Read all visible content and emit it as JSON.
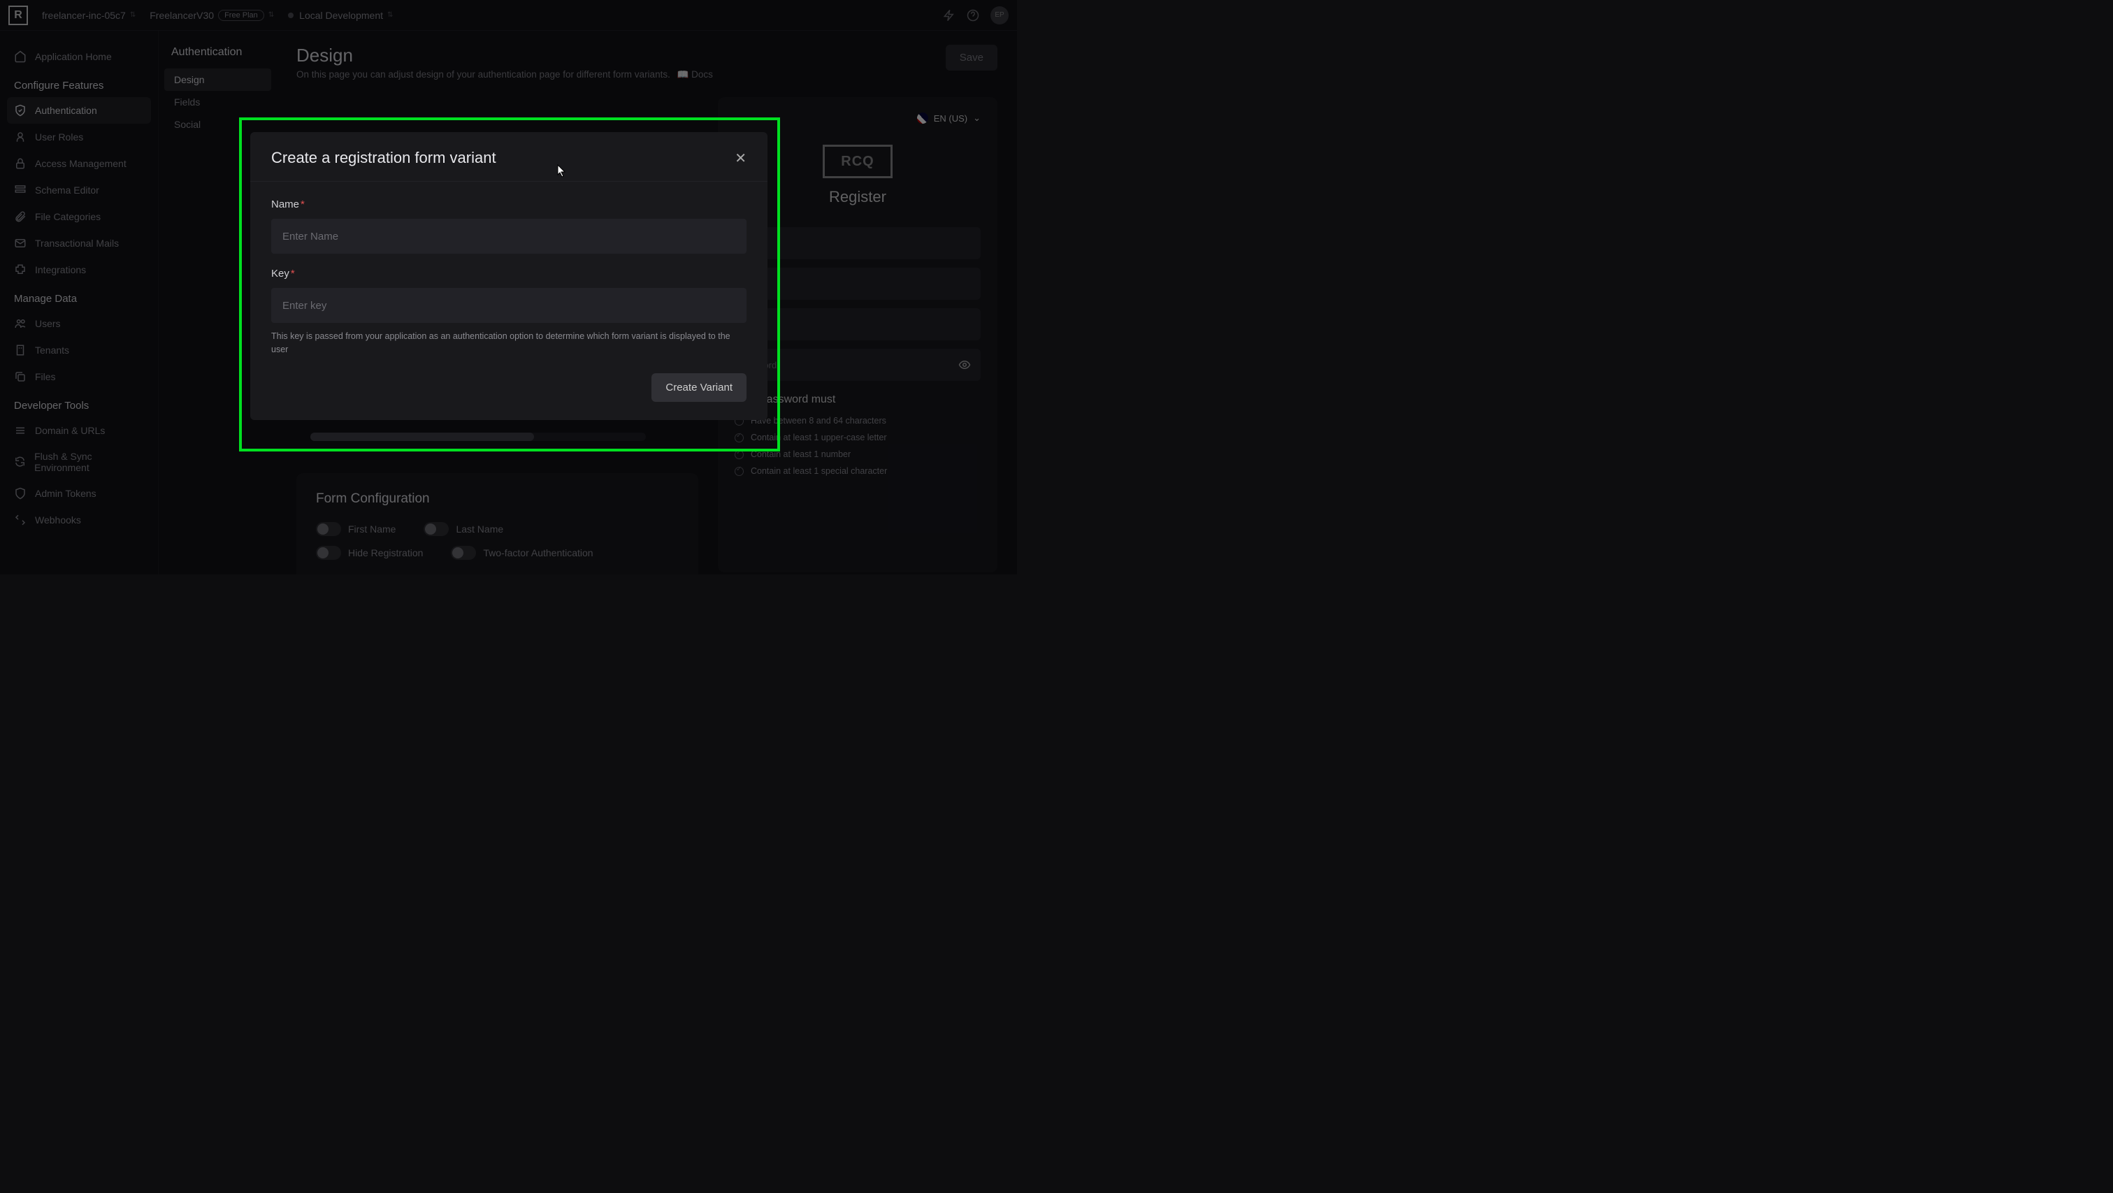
{
  "topbar": {
    "org": "freelancer-inc-05c7",
    "project": "FreelancerV30",
    "plan_badge": "Free Plan",
    "env": "Local Development",
    "avatar_initials": "EP"
  },
  "sidebar": {
    "home": "Application Home",
    "section_configure": "Configure Features",
    "items_configure": [
      "Authentication",
      "User Roles",
      "Access Management",
      "Schema Editor",
      "File Categories",
      "Transactional Mails",
      "Integrations"
    ],
    "section_manage": "Manage Data",
    "items_manage": [
      "Users",
      "Tenants",
      "Files"
    ],
    "section_dev": "Developer Tools",
    "items_dev": [
      "Domain & URLs",
      "Flush & Sync Environment",
      "Admin Tokens",
      "Webhooks"
    ]
  },
  "sidebar2": {
    "title": "Authentication",
    "items": [
      "Design",
      "Fields",
      "Social"
    ]
  },
  "page": {
    "title": "Design",
    "desc": "On this page you can adjust design of your authentication page for different form variants.",
    "docs": "Docs",
    "save": "Save",
    "form_config_title": "Form Configuration",
    "toggles": [
      "First Name",
      "Last Name",
      "Hide Registration",
      "Two-factor Authentication"
    ]
  },
  "preview": {
    "lang": "EN (US)",
    "logo_text": "RCQ",
    "title": "Register",
    "password_placeholder": "*ssword",
    "pw_heading": "Your password must",
    "rules": [
      "Have between 8 and 64 characters",
      "Contain at least 1 upper-case letter",
      "Contain at least 1 number",
      "Contain at least 1 special character"
    ]
  },
  "modal": {
    "title": "Create a registration form variant",
    "name_label": "Name",
    "name_placeholder": "Enter Name",
    "key_label": "Key",
    "key_placeholder": "Enter key",
    "key_helper": "This key is passed from your application as an authentication option to determine which form variant is displayed to the user",
    "create_btn": "Create Variant"
  }
}
